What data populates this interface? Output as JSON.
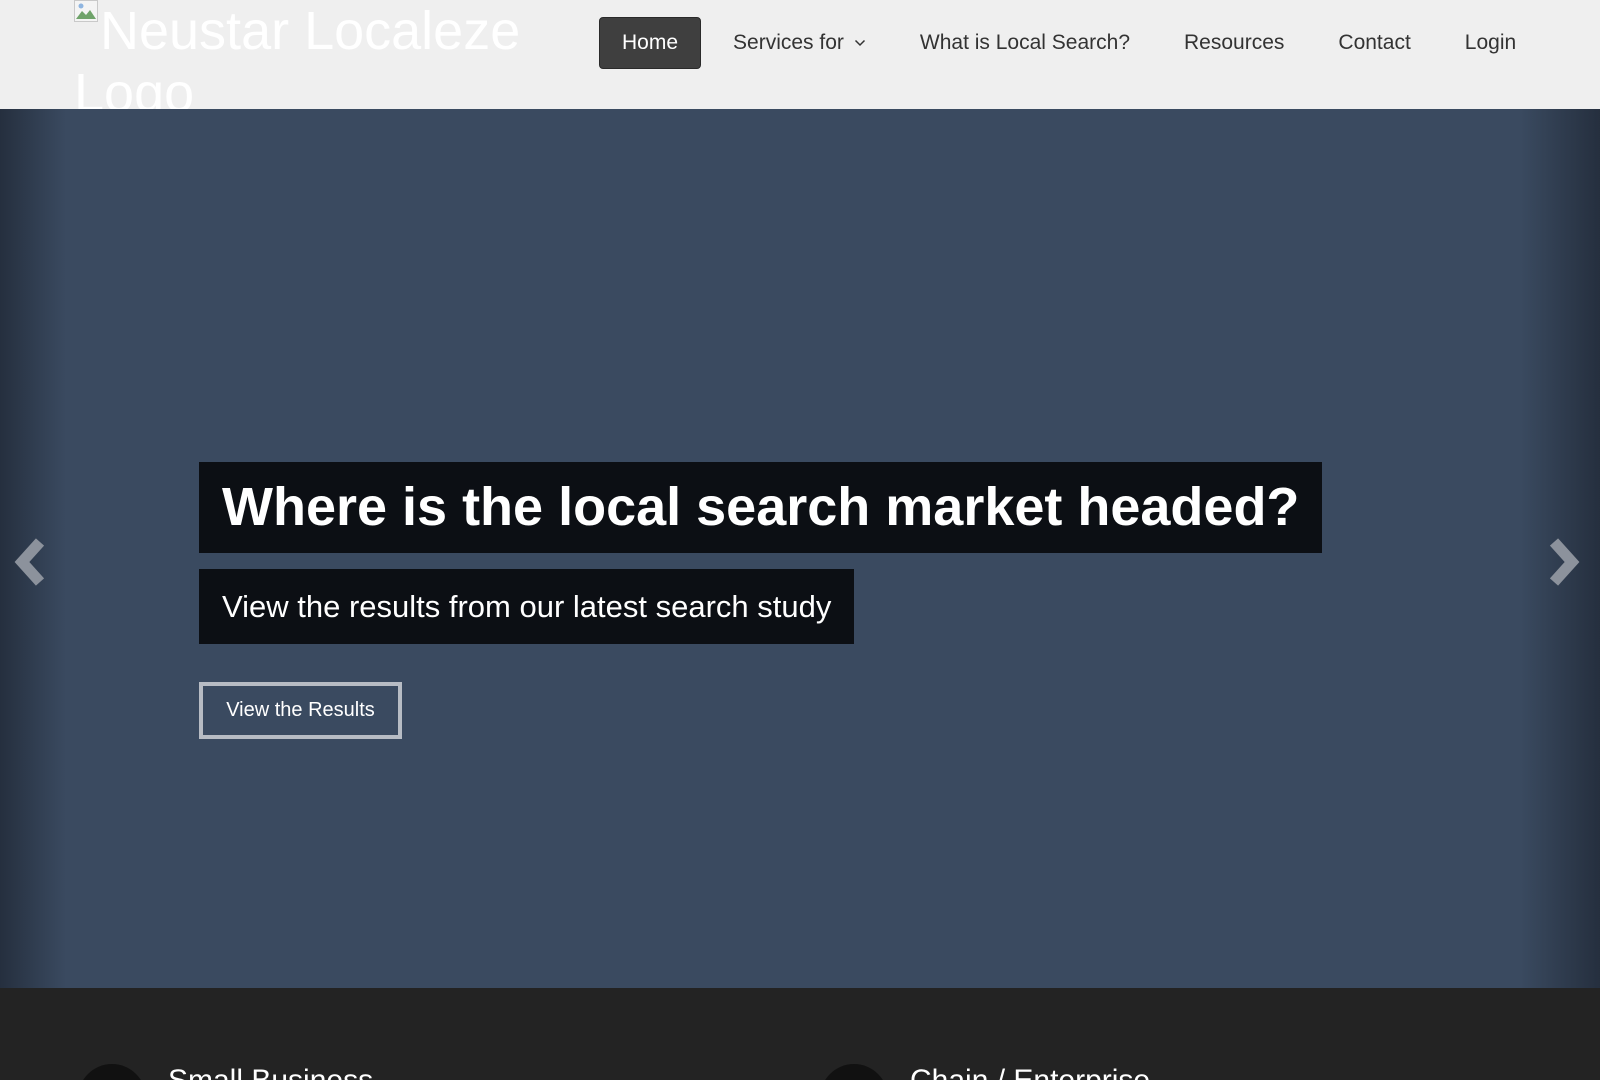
{
  "header": {
    "logo_alt": "Neustar Localeze Logo",
    "nav": [
      {
        "label": "Home",
        "active": true
      },
      {
        "label": "Services for",
        "has_dropdown": true
      },
      {
        "label": "What is Local Search?"
      },
      {
        "label": "Resources"
      },
      {
        "label": "Contact"
      },
      {
        "label": "Login"
      }
    ]
  },
  "hero": {
    "title": "Where is the local search market headed?",
    "subtitle": "View the results from our latest search study",
    "button_label": "View the Results",
    "prev_icon": "chevron-left-icon",
    "next_icon": "chevron-right-icon"
  },
  "sections": [
    {
      "title": "Small Business"
    },
    {
      "title": "Chain / Enterprise"
    }
  ],
  "colors": {
    "header_bg": "#efefef",
    "nav_active_bg": "#3f3f3f",
    "hero_bg": "#3a4a60",
    "caption_bg": "#0c0f14",
    "footer_bg": "#232323"
  }
}
